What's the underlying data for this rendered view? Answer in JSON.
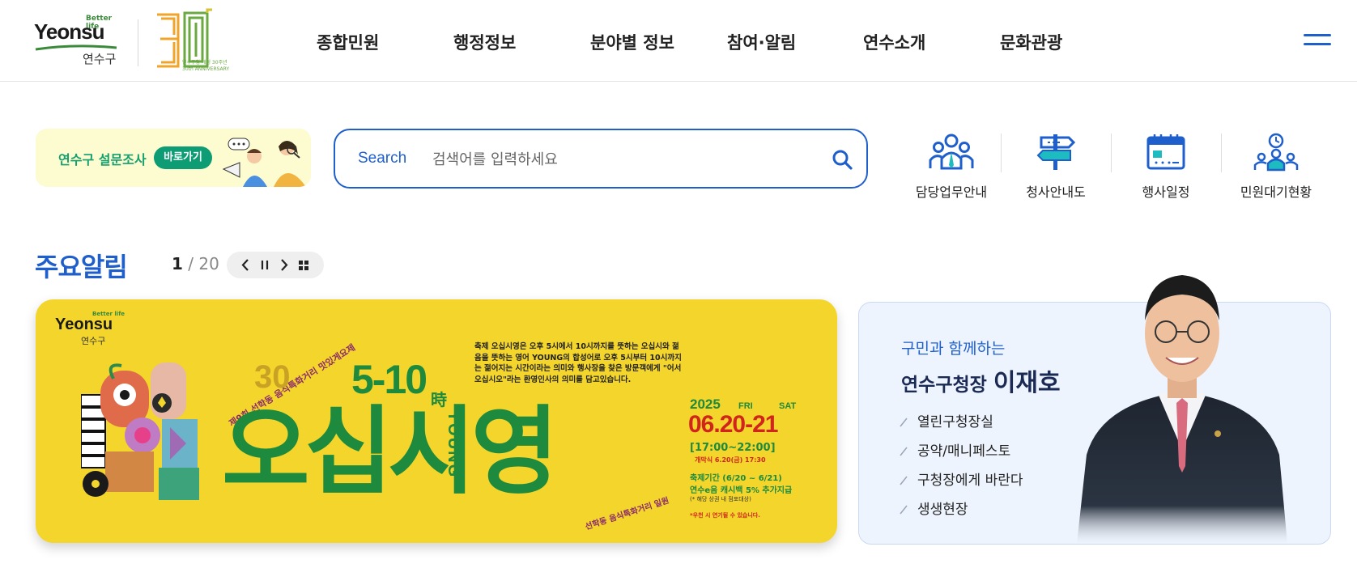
{
  "header": {
    "logo": {
      "better_life": "Better life",
      "brand": "Yeonsu",
      "korean": "연수구"
    },
    "anniversary": {
      "numeral": "30",
      "caption_ko": "연수구청 개청 30주년",
      "caption_en": "30th ANNIVERSARY"
    },
    "nav": [
      "종합민원",
      "행정정보",
      "분야별 정보",
      "참여·알림",
      "연수소개",
      "문화관광"
    ],
    "menu_icon": "hamburger-icon"
  },
  "survey": {
    "text": "연수구 설문조사",
    "button": "바로가기"
  },
  "search": {
    "label": "Search",
    "placeholder": "검색어를 입력하세요",
    "icon": "magnifier-icon"
  },
  "quick_links": [
    {
      "label": "담당업무안내",
      "icon": "staff-group-icon"
    },
    {
      "label": "청사안내도",
      "icon": "signpost-icon"
    },
    {
      "label": "행사일정",
      "icon": "calendar-icon"
    },
    {
      "label": "민원대기현황",
      "icon": "waiting-clock-icon"
    }
  ],
  "notice": {
    "title": "주요알림",
    "current": "1",
    "total": "20"
  },
  "banner": {
    "logo_brand": "Yeonsu",
    "logo_better": "Better life",
    "logo_ko": "연수구",
    "arc_text": "제9회 선학동 음식특화거리 맛있게요제",
    "anniv": "30",
    "hours": "5-10",
    "hours_suffix": "時",
    "young": "YOUNG",
    "title": "오십시영",
    "description": "축제 오십시영은 오후 5시에서 10시까지를 뜻하는 오십시와 젊음을 뜻하는 영어 YOUNG의 합성어로 오후 5시부터 10시까지는 젊어지는 시간이라는 의미와 행사장을 찾은 방문객에게 \"어서오십시오\"라는 환영인사의 의미를 담고있습니다.",
    "year": "2025",
    "day1": "FRI",
    "day2": "SAT",
    "dates": "06.20-21",
    "time": "[17:00~22:00]",
    "opening": "개막식 6.20(금) 17:30",
    "period": "축제기간 (6/20 ~ 6/21)",
    "cashback": "연수e음 캐시백 5% 추가지급",
    "note": "(* 해당 상권 내 점포대상)",
    "rain": "*우천 시 연기될 수 있습니다.",
    "bottom_arc": "선학동 음식특화거리 일원",
    "colors": {
      "background": "#f3d52c",
      "green": "#1d8a3d",
      "red": "#d1241c"
    }
  },
  "mayor": {
    "subtitle": "구민과 함께하는",
    "title_prefix": "연수구청장",
    "name": "이재호",
    "links": [
      "열린구청장실",
      "공약/매니페스토",
      "구청장에게 바란다",
      "생생현장"
    ]
  },
  "colors": {
    "primary_blue": "#1f5fcc",
    "survey_green": "#0d9c73"
  }
}
